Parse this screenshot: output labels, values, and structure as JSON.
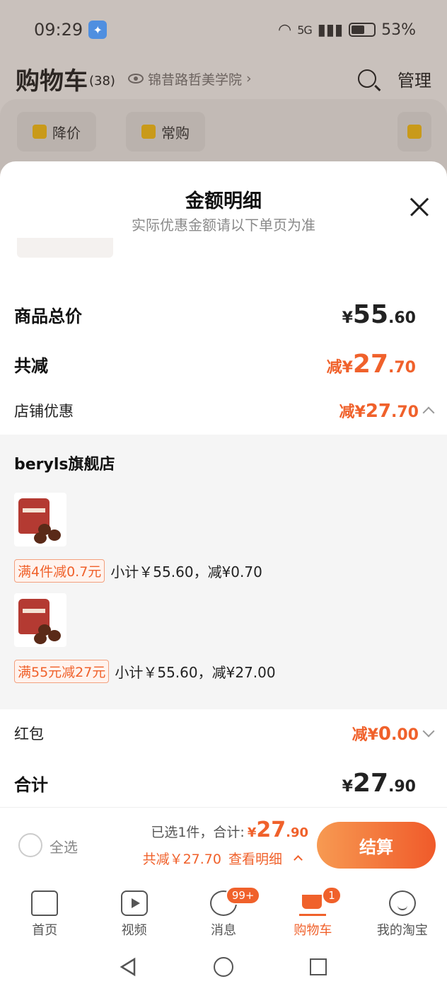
{
  "status": {
    "time": "09:29",
    "network": "5G",
    "battery": "53%"
  },
  "header": {
    "title": "购物车",
    "count": "(38)",
    "location": "锦昔路哲美学院",
    "manage": "管理"
  },
  "chips": [
    {
      "label": "降价"
    },
    {
      "label": "常购"
    }
  ],
  "sheet": {
    "title": "金额明细",
    "subtitle": "实际优惠金额请以下单页为准",
    "goods_total_label": "商品总价",
    "goods_total_yen": "¥",
    "goods_total_int": "55",
    "goods_total_dec": ".60",
    "total_discount_label": "共减",
    "total_discount_prefix": "减¥",
    "total_discount_int": "27",
    "total_discount_dec": ".70",
    "store_discount_label": "店铺优惠",
    "store_discount_prefix": "减¥",
    "store_discount_int": "27",
    "store_discount_dec": ".70",
    "store_name": "beryls旗舰店",
    "items": [
      {
        "promo": "满4件减0.7元",
        "detail": "小计￥55.60，减¥0.70"
      },
      {
        "promo": "满55元减27元",
        "detail": "小计￥55.60，减¥27.00"
      }
    ],
    "red_packet_label": "红包",
    "red_packet_prefix": "减¥",
    "red_packet_int": "0",
    "red_packet_dec": ".00",
    "sum_label": "合计",
    "sum_yen": "¥",
    "sum_int": "27",
    "sum_dec": ".90"
  },
  "checkout": {
    "select_all": "全选",
    "selected_text": "已选1件，合计:",
    "price_yen": "¥",
    "price_int": "27",
    "price_dec": ".90",
    "discount_text": "共减￥27.70",
    "detail_link": "查看明细",
    "pay_button": "结算"
  },
  "tabs": [
    {
      "label": "首页",
      "icon": "home-icon"
    },
    {
      "label": "视频",
      "icon": "video-icon"
    },
    {
      "label": "消息",
      "icon": "message-icon",
      "badge": "99+"
    },
    {
      "label": "购物车",
      "icon": "cart-icon",
      "badge": "1",
      "active": true
    },
    {
      "label": "我的淘宝",
      "icon": "profile-icon"
    }
  ],
  "colors": {
    "accent": "#f0612b",
    "accent_light": "#f79a52"
  }
}
